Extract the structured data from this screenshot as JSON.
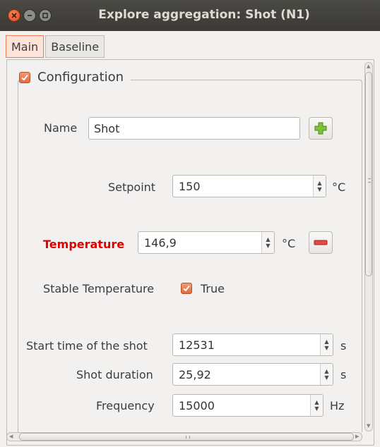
{
  "window": {
    "title": "Explore aggregation: Shot  (N1)"
  },
  "tabs": [
    {
      "label": "Main",
      "active": true
    },
    {
      "label": "Baseline",
      "active": false
    }
  ],
  "group": {
    "label": "Configuration",
    "checked": true
  },
  "fields": {
    "name": {
      "label": "Name",
      "value": "Shot"
    },
    "setpoint": {
      "label": "Setpoint",
      "value": "150",
      "unit": "°C"
    },
    "temperature": {
      "label": "Temperature",
      "value": "146,9",
      "unit": "°C"
    },
    "stable": {
      "label": "Stable Temperature",
      "value": "True",
      "checked": true
    },
    "start_time": {
      "label": "Start time of the shot",
      "value": "12531",
      "unit": "s"
    },
    "duration": {
      "label": "Shot duration",
      "value": "25,92",
      "unit": "s"
    },
    "frequency": {
      "label": "Frequency",
      "value": "15000",
      "unit": "Hz"
    }
  },
  "icons": {
    "add": "plus-icon",
    "remove": "minus-icon"
  },
  "colors": {
    "accent": "#e46a3c",
    "warning": "#e00000",
    "add_green": "#6cb02d",
    "remove_red": "#d63a3a"
  }
}
